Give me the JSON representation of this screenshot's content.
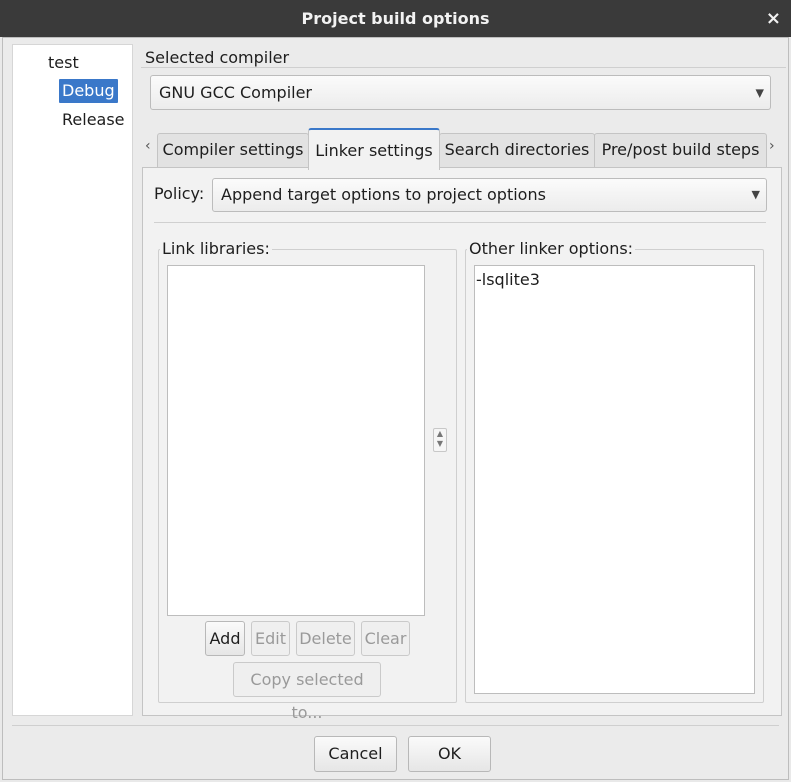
{
  "window": {
    "title": "Project build options",
    "close_glyph": "×"
  },
  "tree": {
    "root": "test",
    "items": [
      "Debug",
      "Release"
    ],
    "selected": "Debug"
  },
  "compiler": {
    "group_label": "Selected compiler",
    "value": "GNU GCC Compiler"
  },
  "tabs": {
    "items": [
      "Compiler settings",
      "Linker settings",
      "Search directories",
      "Pre/post build steps"
    ],
    "active": "Linker settings",
    "scroll_left": "‹",
    "scroll_right": "›"
  },
  "policy": {
    "label": "Policy:",
    "value": "Append target options to project options"
  },
  "link_libraries": {
    "label": "Link libraries:",
    "items": [],
    "buttons": {
      "add": "Add",
      "edit": "Edit",
      "delete": "Delete",
      "clear": "Clear",
      "copy": "Copy selected to..."
    }
  },
  "other_linker": {
    "label": "Other linker options:",
    "text": "-lsqlite3"
  },
  "footer": {
    "cancel": "Cancel",
    "ok": "OK"
  },
  "icons": {
    "close": "close-icon",
    "dropdown": "chevron-down-icon",
    "splitter": "splitter-handle-icon"
  },
  "colors": {
    "titlebar": "#3a3a3a",
    "selection": "#3a78c9",
    "tab_accent": "#3a78c9"
  }
}
